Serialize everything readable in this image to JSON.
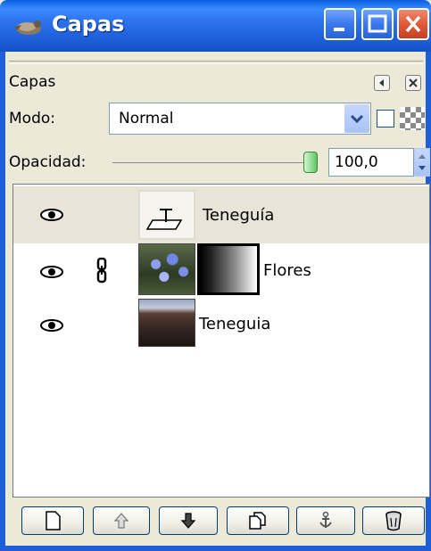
{
  "window": {
    "title": "Capas"
  },
  "panel": {
    "header": "Capas",
    "mode_label": "Modo:",
    "mode_value": "Normal",
    "opacity_label": "Opacidad:",
    "opacity_value": "100,0"
  },
  "layers": [
    {
      "name": "Teneguía",
      "visible": true,
      "linked": false,
      "type": "text",
      "selected": true
    },
    {
      "name": "Flores",
      "visible": true,
      "linked": true,
      "type": "image-with-mask",
      "selected": false
    },
    {
      "name": "Teneguia",
      "visible": true,
      "linked": false,
      "type": "image",
      "selected": false
    }
  ],
  "toolbar": {
    "buttons": [
      "new-layer-icon",
      "raise-layer-icon",
      "lower-layer-icon",
      "duplicate-layer-icon",
      "anchor-layer-icon",
      "delete-layer-icon"
    ]
  },
  "colors": {
    "titlebar": "#2D73F0",
    "close": "#E05A3A",
    "selection": "#E9E4D8",
    "face": "#ECE9D8"
  }
}
